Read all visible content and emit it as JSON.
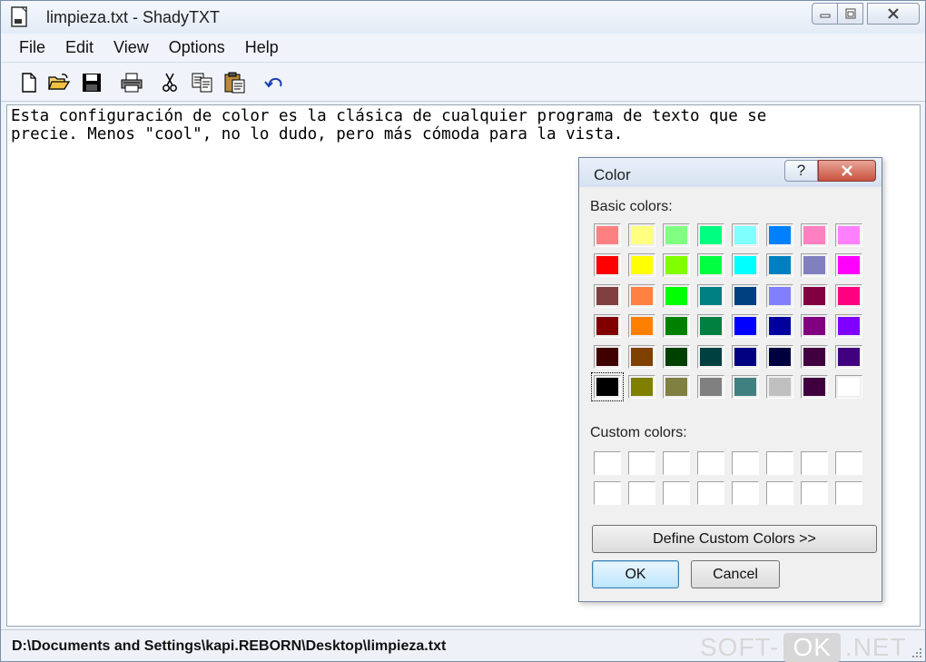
{
  "window": {
    "title": "limpieza.txt - ShadyTXT"
  },
  "menu": [
    {
      "label": "File"
    },
    {
      "label": "Edit"
    },
    {
      "label": "View"
    },
    {
      "label": "Options"
    },
    {
      "label": "Help"
    }
  ],
  "toolbar": {
    "icons": [
      "new-file-icon",
      "open-folder-icon",
      "save-disk-icon",
      "print-icon",
      "cut-icon",
      "copy-icon",
      "paste-icon",
      "undo-icon"
    ]
  },
  "editor": {
    "text": "Esta configuración de color es la clásica de cualquier programa de texto que se\nprecie. Menos \"cool\", no lo dudo, pero más cómoda para la vista.",
    "background": "#ffffff",
    "text_color": "#000000"
  },
  "statusbar": {
    "path": "D:\\Documents and Settings\\kapi.REBORN\\Desktop\\limpieza.txt"
  },
  "watermark": {
    "left": "SOFT-",
    "box": "OK",
    "right": ".NET"
  },
  "color_dialog": {
    "title": "Color",
    "help_label": "?",
    "basic_colors_label": "Basic colors:",
    "custom_colors_label": "Custom colors:",
    "basic_colors": [
      [
        "#ff8080",
        "#ffff80",
        "#80ff80",
        "#00ff80",
        "#80ffff",
        "#0080ff",
        "#ff80c0",
        "#ff80ff"
      ],
      [
        "#ff0000",
        "#ffff00",
        "#80ff00",
        "#00ff40",
        "#00ffff",
        "#0080c0",
        "#8080c0",
        "#ff00ff"
      ],
      [
        "#804040",
        "#ff8040",
        "#00ff00",
        "#008080",
        "#004080",
        "#8080ff",
        "#800040",
        "#ff0080"
      ],
      [
        "#800000",
        "#ff8000",
        "#008000",
        "#008040",
        "#0000ff",
        "#0000a0",
        "#800080",
        "#8000ff"
      ],
      [
        "#400000",
        "#804000",
        "#004000",
        "#004040",
        "#000080",
        "#000040",
        "#400040",
        "#400080"
      ],
      [
        "#000000",
        "#808000",
        "#808040",
        "#808080",
        "#408080",
        "#c0c0c0",
        "#400040",
        "#ffffff"
      ]
    ],
    "selected_color": "#000000",
    "custom_colors": [
      [
        "#ffffff",
        "#ffffff",
        "#ffffff",
        "#ffffff",
        "#ffffff",
        "#ffffff",
        "#ffffff",
        "#ffffff"
      ],
      [
        "#ffffff",
        "#ffffff",
        "#ffffff",
        "#ffffff",
        "#ffffff",
        "#ffffff",
        "#ffffff",
        "#ffffff"
      ]
    ],
    "define_custom_label": "Define Custom Colors >>",
    "ok_label": "OK",
    "cancel_label": "Cancel"
  }
}
